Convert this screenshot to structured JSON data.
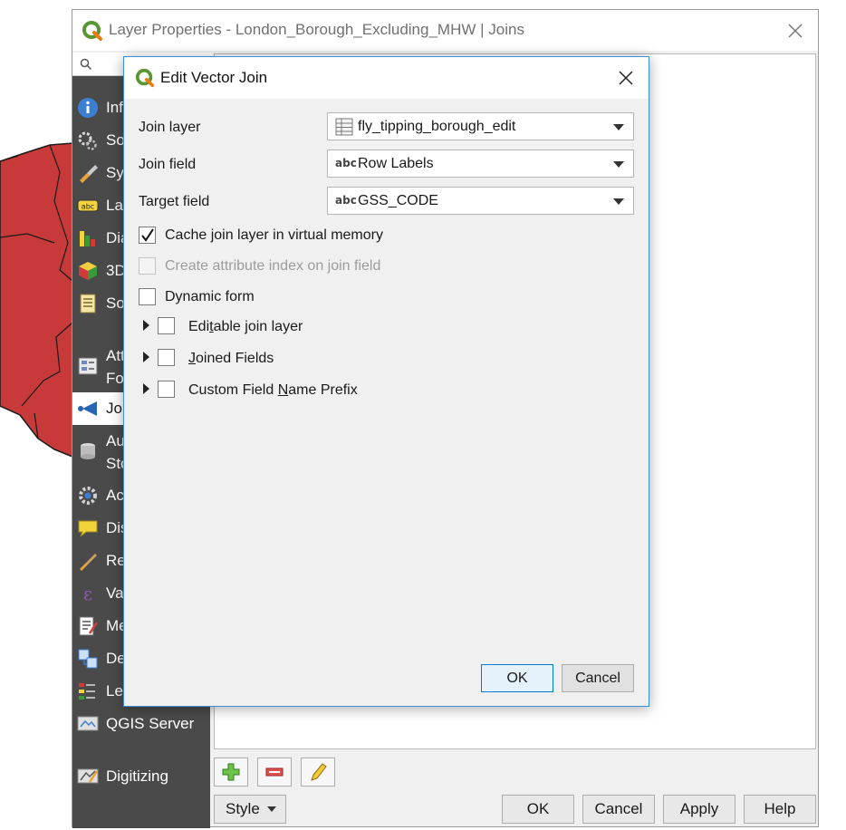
{
  "main_window": {
    "title": "Layer Properties - London_Borough_Excluding_MHW | Joins",
    "search": {
      "placeholder": ""
    },
    "sidebar": {
      "items": [
        {
          "label": "Inf",
          "icon": "information-icon"
        },
        {
          "label": "So",
          "icon": "source-icon"
        },
        {
          "label": "Syı",
          "icon": "symbology-icon"
        },
        {
          "label": "Lal",
          "icon": "labels-icon"
        },
        {
          "label": "Dia",
          "icon": "diagrams-icon"
        },
        {
          "label": "3D",
          "icon": "3d-view-icon"
        },
        {
          "label": "Soı",
          "icon": "source-fields-icon"
        },
        {
          "label": "Att",
          "label2": "Fo",
          "icon": "attributes-form-icon"
        },
        {
          "label": "Jo",
          "icon": "joins-icon",
          "active": true
        },
        {
          "label": "Au",
          "label2": "Sto",
          "icon": "auxiliary-storage-icon"
        },
        {
          "label": "Ac",
          "icon": "actions-icon"
        },
        {
          "label": "Dis",
          "icon": "display-icon"
        },
        {
          "label": "Re",
          "icon": "rendering-icon"
        },
        {
          "label": "Va",
          "icon": "variables-icon"
        },
        {
          "label": "Me",
          "icon": "metadata-icon"
        },
        {
          "label": "De",
          "icon": "dependencies-icon"
        },
        {
          "label": "Leg",
          "icon": "legend-icon"
        },
        {
          "label": "QGIS Server",
          "icon": "qgis-server-icon"
        },
        {
          "label": "Digitizing",
          "icon": "digitizing-icon"
        }
      ]
    },
    "toolbar": {
      "add_icon": "add-join-icon",
      "remove_icon": "remove-join-icon",
      "edit_icon": "edit-join-icon"
    },
    "buttons": {
      "style": "Style",
      "ok": "OK",
      "cancel": "Cancel",
      "apply": "Apply",
      "help": "Help"
    }
  },
  "dialog": {
    "title": "Edit Vector Join",
    "join_layer": {
      "label": "Join layer",
      "value": "fly_tipping_borough_edit",
      "icon": "table-layer-icon"
    },
    "join_field": {
      "label": "Join field",
      "value": "Row Labels",
      "icon": "abc",
      "icon_name": "text-field-icon"
    },
    "target_field": {
      "label": "Target field",
      "value": "GSS_CODE",
      "icon": "abc",
      "icon_name": "text-field-icon"
    },
    "options": {
      "cache": {
        "label": "Cache join layer in virtual memory",
        "checked": true
      },
      "index": {
        "label": "Create attribute index on join field",
        "checked": false,
        "disabled": true
      },
      "dynamic": {
        "label": "Dynamic form",
        "checked": false
      }
    },
    "groups": {
      "editable": {
        "pre": "Edi",
        "accel": "t",
        "post": "able join layer",
        "checked": false
      },
      "joined": {
        "pre": "",
        "accel": "J",
        "post": "oined Fields",
        "checked": false
      },
      "prefix": {
        "pre": "Custom Field ",
        "accel": "N",
        "post": "ame Prefix",
        "checked": false
      }
    },
    "buttons": {
      "ok": "OK",
      "cancel": "Cancel"
    }
  },
  "colors": {
    "map_fill": "#c83a3a",
    "sidebar_bg": "#4a4a4a",
    "accent": "#0078d7",
    "qgis_green": "#589632"
  }
}
